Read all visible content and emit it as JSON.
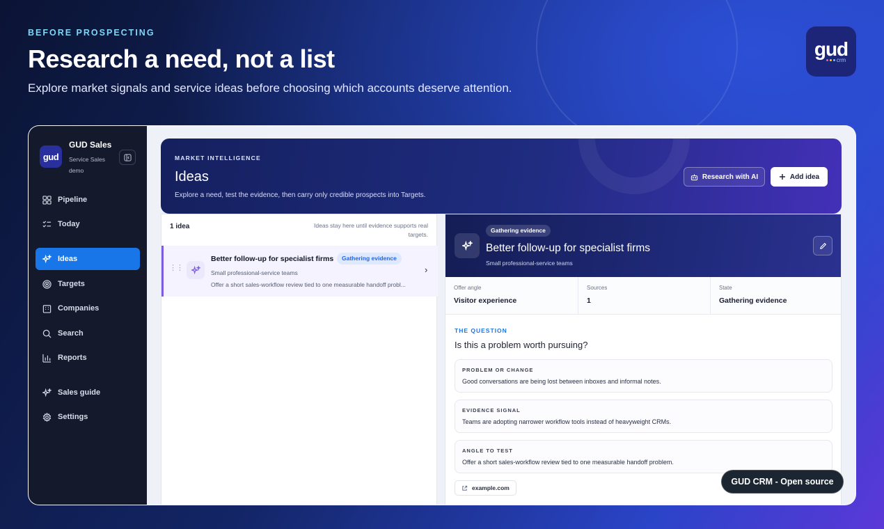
{
  "hero": {
    "eyebrow": "BEFORE PROSPECTING",
    "title": "Research a need, not a list",
    "subtitle": "Explore market signals and service ideas before choosing which accounts deserve attention.",
    "brand_logo": "gud",
    "brand_sub": "crm"
  },
  "sidebar": {
    "workspace_logo": "gud",
    "workspace_name": "GUD Sales",
    "workspace_sub": "Service Sales demo",
    "items": [
      {
        "label": "Pipeline",
        "icon": "grid-icon"
      },
      {
        "label": "Today",
        "icon": "checklist-icon"
      },
      {
        "label": "Ideas",
        "icon": "sparkle-icon",
        "active": true
      },
      {
        "label": "Targets",
        "icon": "target-icon"
      },
      {
        "label": "Companies",
        "icon": "building-icon"
      },
      {
        "label": "Search",
        "icon": "search-icon"
      },
      {
        "label": "Reports",
        "icon": "bar-chart-icon"
      },
      {
        "label": "Sales guide",
        "icon": "sparkle-icon"
      },
      {
        "label": "Settings",
        "icon": "gear-icon"
      }
    ]
  },
  "banner": {
    "eyebrow": "MARKET INTELLIGENCE",
    "title": "Ideas",
    "subtitle": "Explore a need, test the evidence, then carry only credible prospects into Targets.",
    "research_label": "Research with AI",
    "add_label": "Add idea"
  },
  "list": {
    "count": "1 idea",
    "note": "Ideas stay here until evidence supports real targets.",
    "items": [
      {
        "title": "Better follow-up for specialist firms",
        "badge": "Gathering evidence",
        "audience": "Small professional-service teams",
        "desc": "Offer a short sales-workflow review tied to one measurable handoff probl..."
      }
    ]
  },
  "detail": {
    "badge": "Gathering evidence",
    "title": "Better follow-up for specialist firms",
    "subtitle": "Small professional-service teams",
    "facts": [
      {
        "label": "Offer angle",
        "value": "Visitor experience"
      },
      {
        "label": "Sources",
        "value": "1"
      },
      {
        "label": "State",
        "value": "Gathering evidence"
      }
    ],
    "question_eyebrow": "THE QUESTION",
    "question": "Is this a problem worth pursuing?",
    "cards": [
      {
        "label": "PROBLEM OR CHANGE",
        "text": "Good conversations are being lost between inboxes and informal notes."
      },
      {
        "label": "EVIDENCE SIGNAL",
        "text": "Teams are adopting narrower workflow tools instead of heavyweight CRMs."
      },
      {
        "label": "ANGLE TO TEST",
        "text": "Offer a short sales-workflow review tied to one measurable handoff problem."
      }
    ],
    "source": "example.com"
  },
  "footer_pill": "GUD CRM - Open source",
  "colors": {
    "accent": "#1876e8",
    "sidebar_bg": "#141a2b",
    "badge_bg": "#dde9ff",
    "badge_text": "#2563eb"
  }
}
